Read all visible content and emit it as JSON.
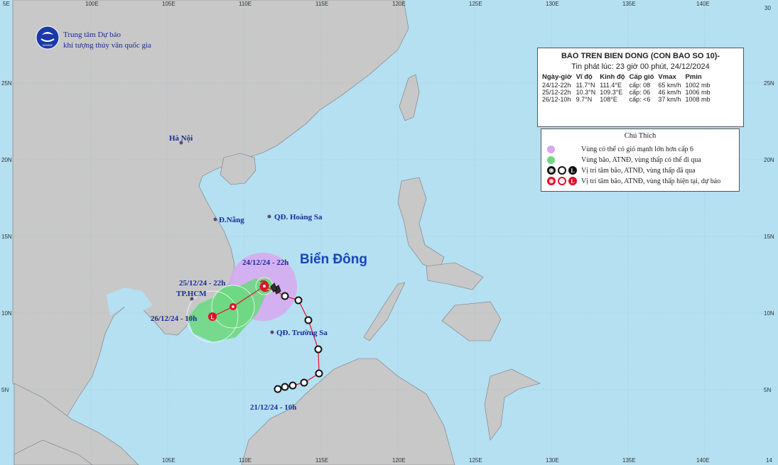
{
  "center": {
    "line1": "Trung tâm Dự báo",
    "line2": "khí tượng thủy văn quốc gia",
    "logo_text": "NCHMF"
  },
  "info_box": {
    "title": "BAO TREN BIEN DONG (CON BAO SO 10)-",
    "issued": "Tin phát lúc: 23 giờ 00 phút, 24/12/2024",
    "headers": [
      "Ngày-giờ",
      "Vĩ độ",
      "Kinh độ",
      "Cấp gió",
      "Vmax",
      "Pmin"
    ],
    "rows": [
      [
        "24/12-22h",
        "11.7°N",
        "111.4°E",
        "cấp: 08",
        "65 km/h",
        "1002 mb"
      ],
      [
        "25/12-22h",
        "10.3°N",
        "109.3°E",
        "cấp: 06",
        "46 km/h",
        "1006 mb"
      ],
      [
        "26/12-10h",
        "9.7°N",
        "108°E",
        "cấp: <6",
        "37 km/h",
        "1008 mb"
      ]
    ]
  },
  "legend": {
    "title": "Chú Thích",
    "items": [
      {
        "label": "Vùng có thể có gió mạnh lớn hơn cấp 6",
        "color": "#d8a8f0"
      },
      {
        "label": "Vùng bão, ATNĐ, vùng thấp có thể đi qua",
        "color": "#6fd882"
      },
      {
        "label": "Vị trí tâm bão, ATNĐ, vùng thấp đã qua",
        "color": "#111111"
      },
      {
        "label": "Vị trí tâm bão, ATNĐ, vùng thấp hiện tại, dự báo",
        "color": "#e0102a"
      }
    ]
  },
  "graticule": {
    "lon_labels": [
      "100E",
      "105E",
      "110E",
      "115E",
      "120E",
      "125E",
      "130E",
      "135E",
      "140E"
    ],
    "lat_labels": [
      "25N",
      "20N",
      "15N",
      "10N",
      "5N"
    ],
    "top_left": "5E",
    "right_top": "30",
    "bottom_right": "14"
  },
  "places": {
    "hanoi": "Hà Nội",
    "danang": "Đ.Nẵng",
    "hoangsa": "QĐ. Hoàng Sa",
    "truongsa": "QĐ. Trường Sa",
    "hcm": "TP.HCM",
    "sea": "Biển Đông"
  },
  "track_labels": {
    "current": "24/12/24 - 22h",
    "forecast1": "25/12/24 - 22h",
    "forecast2": "26/12/24 - 10h",
    "origin": "21/12/24 - 10h"
  },
  "colors": {
    "sea": "#b4e0f2",
    "land": "#c8c8c8",
    "wind_zone": "#d8a8f0",
    "cone": "#6fd882",
    "track": "#e0102a",
    "past_symbol": "#111111",
    "label_blue": "#1a2a9c"
  }
}
